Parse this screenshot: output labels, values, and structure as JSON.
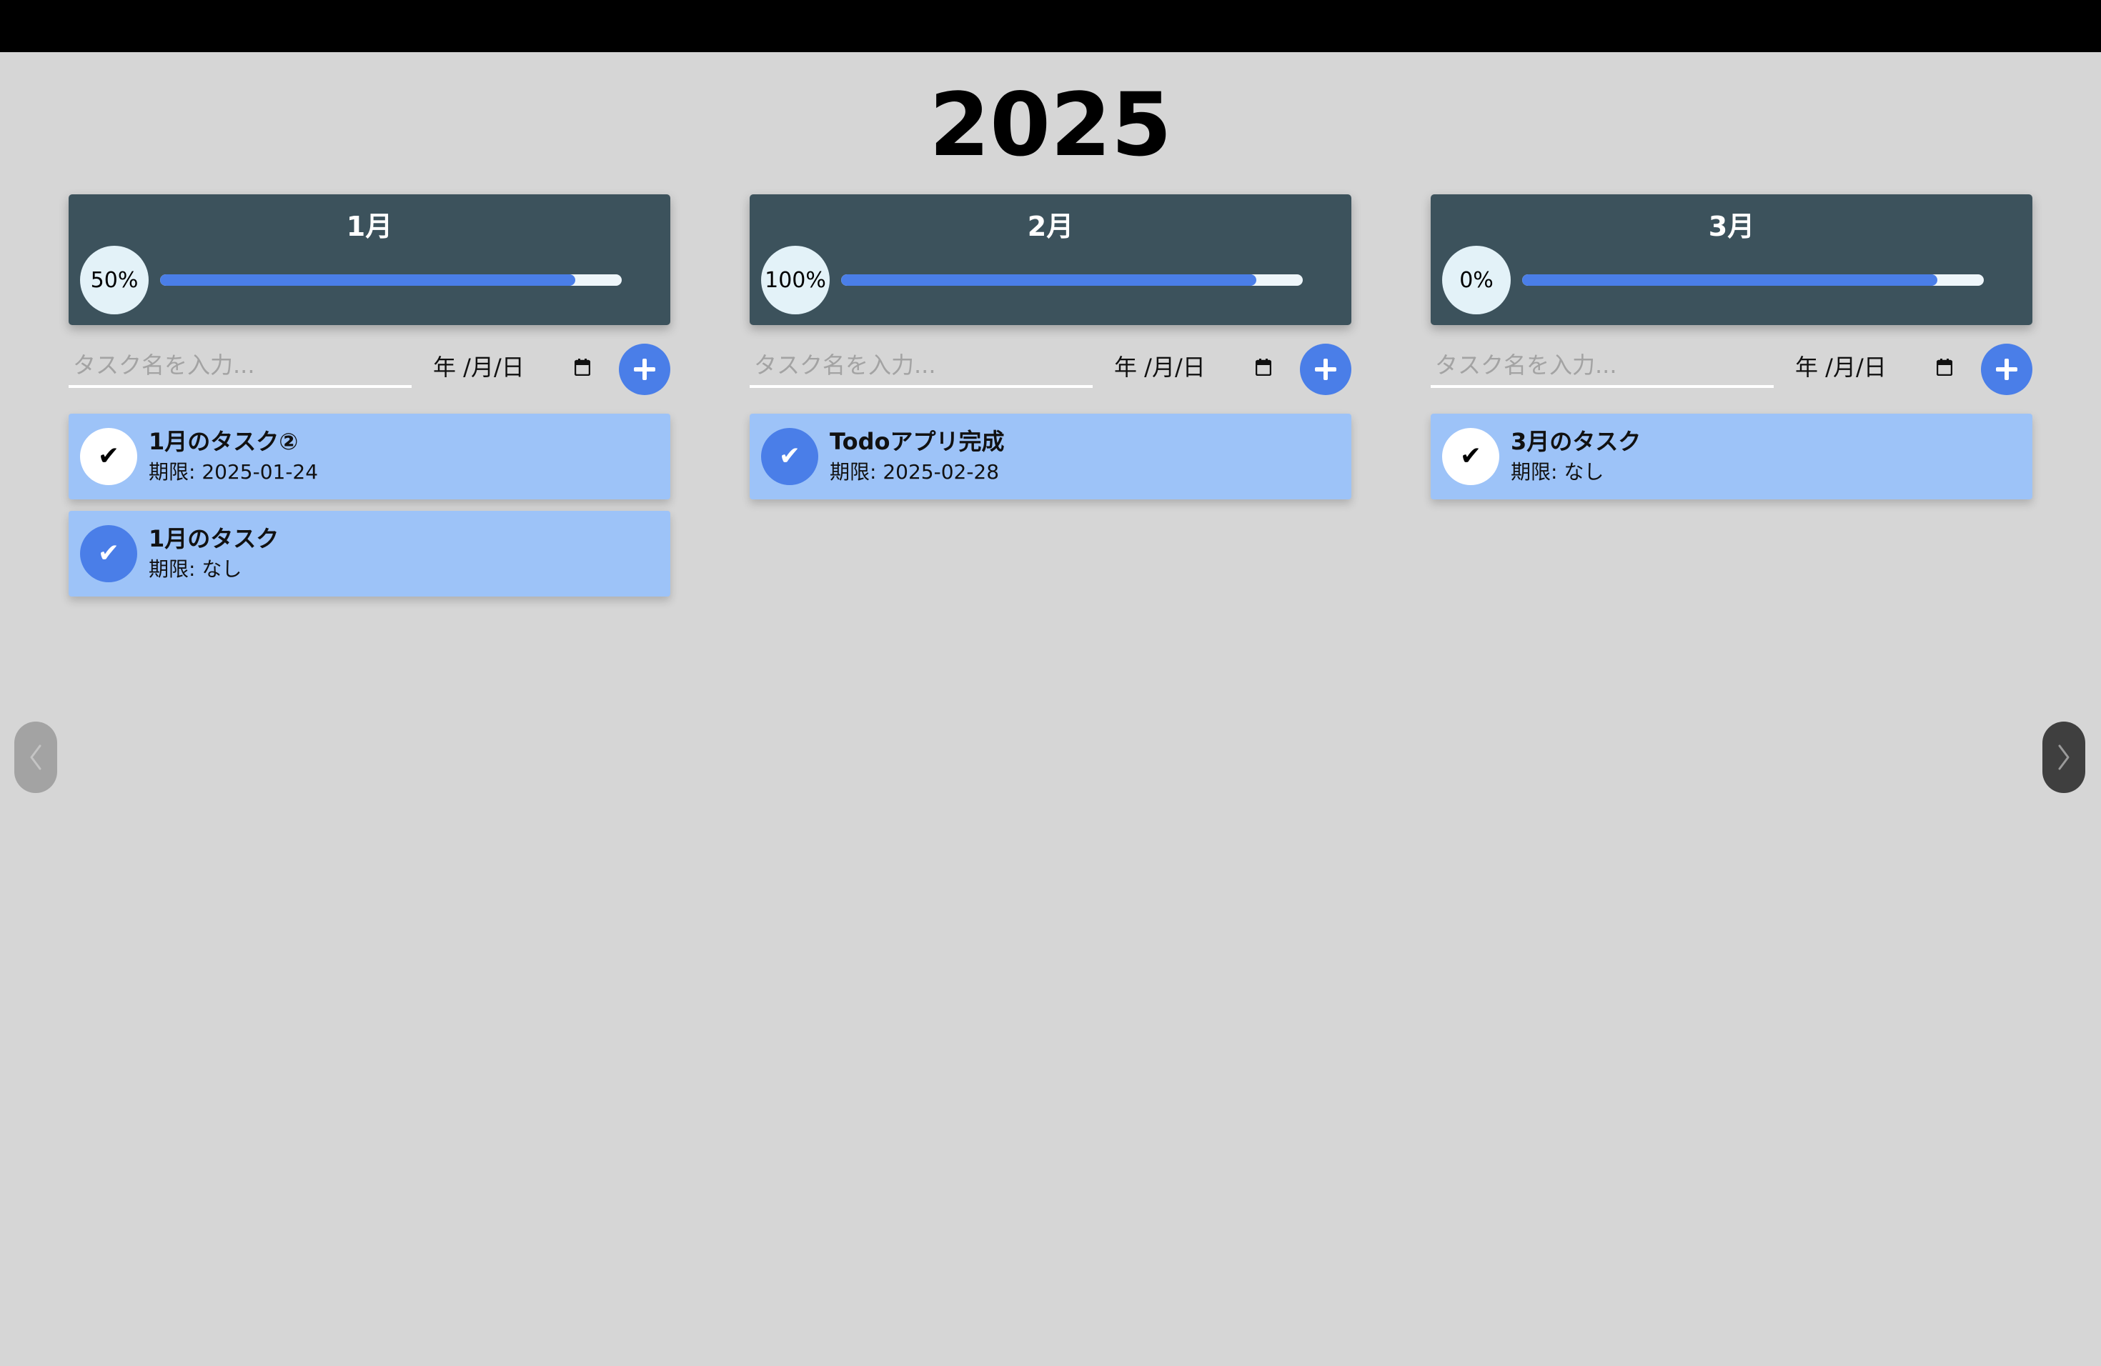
{
  "year_title": "2025",
  "colors": {
    "background": "#d6d6d6",
    "header_bg": "#3c525c",
    "accent": "#4a7ee8",
    "task_bg": "#9dc3f8",
    "track_bg": "#eef6fa"
  },
  "months": [
    {
      "name": "1月",
      "percent_label": "50%",
      "progress_fraction": 0.9,
      "input_placeholder": "タスク名を入力...",
      "date_placeholder": "年 /月/日",
      "tasks": [
        {
          "title": "1月のタスク②",
          "due": "期限: 2025-01-24",
          "done": false
        },
        {
          "title": "1月のタスク",
          "due": "期限: なし",
          "done": true
        }
      ]
    },
    {
      "name": "2月",
      "percent_label": "100%",
      "progress_fraction": 0.9,
      "input_placeholder": "タスク名を入力...",
      "date_placeholder": "年 /月/日",
      "tasks": [
        {
          "title": "Todoアプリ完成",
          "due": "期限: 2025-02-28",
          "done": true
        }
      ]
    },
    {
      "name": "3月",
      "percent_label": "0%",
      "progress_fraction": 0.9,
      "input_placeholder": "タスク名を入力...",
      "date_placeholder": "年 /月/日",
      "tasks": [
        {
          "title": "3月のタスク",
          "due": "期限: なし",
          "done": false
        }
      ]
    }
  ],
  "check_glyph": "✔",
  "icons": {
    "add": "plus-icon",
    "calendar": "calendar-icon",
    "prev": "chevron-left-icon",
    "next": "chevron-right-icon"
  }
}
